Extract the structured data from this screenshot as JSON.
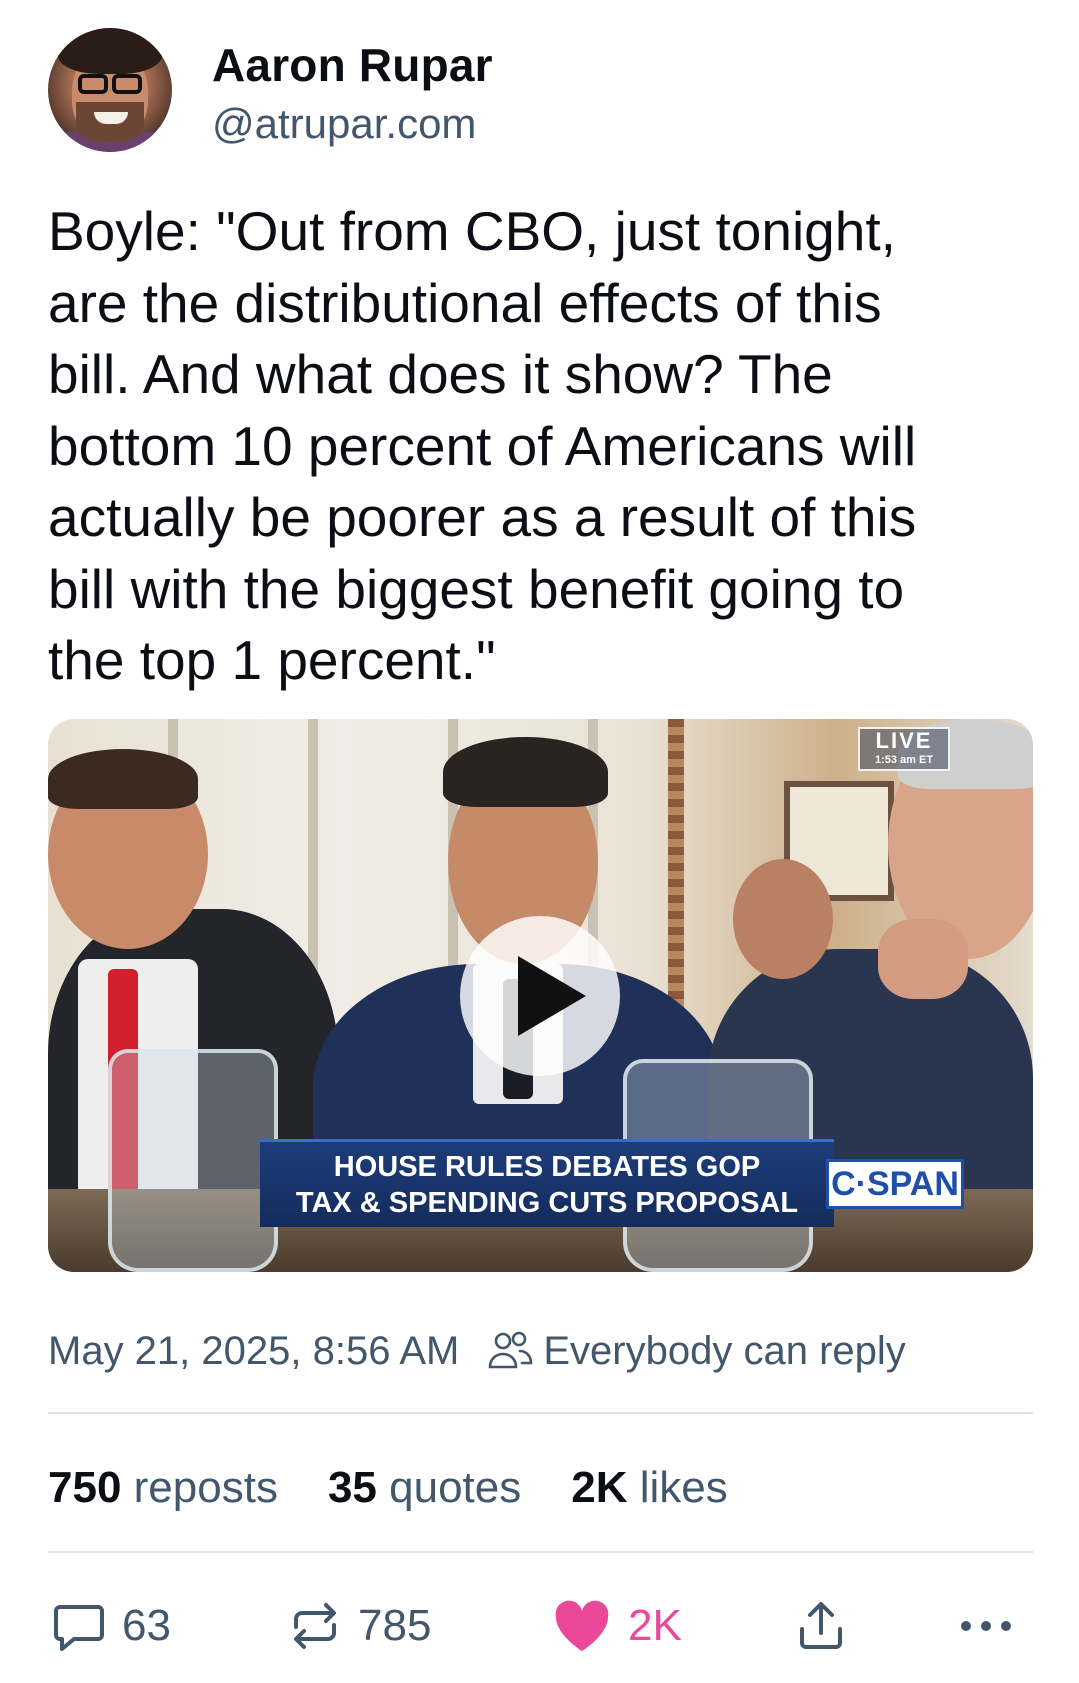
{
  "author": {
    "display_name": "Aaron Rupar",
    "handle": "@atrupar.com"
  },
  "post": {
    "text": "Boyle: \"Out from CBO, just tonight,\nare the distributional effects of this\nbill. And what does it show? The\nbottom 10 percent of Americans will\nactually be poorer as a result of this\nbill with the biggest benefit going to\nthe top 1 percent.\""
  },
  "video": {
    "chyron_line1": "HOUSE RULES DEBATES GOP",
    "chyron_line2": "TAX & SPENDING CUTS PROPOSAL",
    "network": "C·SPAN",
    "live_label": "LIVE",
    "live_time": "1:53 am ET"
  },
  "meta": {
    "timestamp": "May 21, 2025, 8:56 AM",
    "reply_setting": "Everybody can reply"
  },
  "stats": {
    "reposts_count": "750",
    "reposts_label": "reposts",
    "quotes_count": "35",
    "quotes_label": "quotes",
    "likes_count": "2K",
    "likes_label": "likes"
  },
  "actions": {
    "reply_count": "63",
    "repost_count": "785",
    "like_count": "2K"
  },
  "colors": {
    "text_primary": "#0b0f14",
    "text_secondary": "#42576c",
    "like_accent": "#ec4899",
    "divider": "#dfe4ea"
  },
  "icons": [
    "reply-icon",
    "repost-icon",
    "heart-icon",
    "share-icon",
    "more-icon",
    "people-icon",
    "play-icon"
  ]
}
